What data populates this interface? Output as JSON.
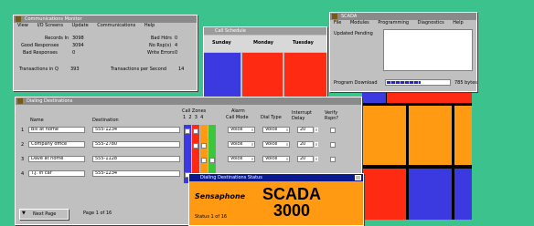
{
  "windows": {
    "stats": {
      "title": "Communications Monitor",
      "menu": [
        "View",
        "I/O Screens",
        "Update",
        "Communications",
        "Help"
      ],
      "left_fields": [
        {
          "label": "Records In",
          "value": "3098"
        },
        {
          "label": "Good Responses",
          "value": "3094"
        },
        {
          "label": "Bad Responses",
          "value": "0"
        }
      ],
      "right_fields": [
        {
          "label": "Bad Hdrs",
          "value": "0"
        },
        {
          "label": "No Rsp(s)",
          "value": "4"
        },
        {
          "label": "Write Errors",
          "value": "0"
        }
      ],
      "footer_left": {
        "label": "Transactions in Q",
        "value": "393"
      },
      "footer_right": {
        "label": "Transactions per Second",
        "value": "14"
      }
    },
    "schedule": {
      "title": "Call Schedule",
      "days": [
        "Sunday",
        "Monday",
        "Tuesday"
      ]
    },
    "diag": {
      "title": "SCADA",
      "menu": [
        "File",
        "Modules",
        "Programming",
        "Diagnostics",
        "Help"
      ],
      "field_label": "Updated Pending",
      "progress_label": "Program Download",
      "progress_value": "785 bytes",
      "progress_fraction": 0.55
    },
    "dialing": {
      "title": "Dialing Destinations",
      "headers": {
        "name": "Name",
        "destination": "Destination",
        "call_zones": "Call Zones",
        "zone_numbers": "1  2  3  4",
        "alarm": "Alarm",
        "call_mode": "Call Mode",
        "dial_type": "Dial Type",
        "interrupt": "Interrupt Delay",
        "verify": "Verify Rspn?"
      },
      "rows": [
        {
          "num": "1",
          "name": "Bill at home",
          "dest": "555-1234",
          "mode": "Voice",
          "type": "Voice",
          "delay": "20",
          "zones": [
            "1",
            "2"
          ]
        },
        {
          "num": "2",
          "name": "Company office",
          "dest": "555-2780",
          "mode": "Voice",
          "type": "Voice",
          "delay": "20",
          "zones": [
            "2",
            "3"
          ]
        },
        {
          "num": "3",
          "name": "Dave at home",
          "dest": "555-1128",
          "mode": "Voice",
          "type": "Voice",
          "delay": "20",
          "zones": [
            "3",
            "4"
          ]
        },
        {
          "num": "4",
          "name": "T.J. in car",
          "dest": "555-1234",
          "mode": "Voice",
          "type": "Voice",
          "delay": "20",
          "zones": [
            "1"
          ]
        }
      ],
      "footer_button": "Next Page",
      "page_label": "Page 1 of 16"
    },
    "readout": {
      "title": "Dialing Destinations Status",
      "label": "Sensaphone",
      "product": "SCADA",
      "model": "3000",
      "sub_label": "Status 1 of 16"
    }
  },
  "colors": {
    "desktop": "#3cc38d",
    "title_bar_inactive": "#8a8a8a",
    "title_bar_active": "#0a1a8e",
    "red": "#ff2a12",
    "blue": "#3a3ae0",
    "orange": "#ff9a12",
    "green": "#3cc63c"
  }
}
